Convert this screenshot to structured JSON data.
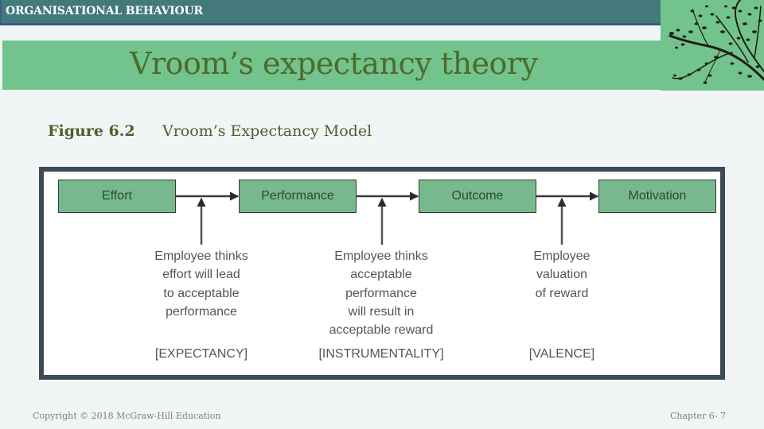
{
  "header": {
    "course_title": "ORGANISATIONAL BEHAVIOUR"
  },
  "slide": {
    "title": "Vroom’s expectancy theory"
  },
  "figure": {
    "label": "Figure 6.2",
    "caption": "Vroom’s Expectancy Model",
    "stages": [
      {
        "label": "Effort"
      },
      {
        "label": "Performance"
      },
      {
        "label": "Outcome"
      },
      {
        "label": "Motivation"
      }
    ],
    "links": [
      {
        "explanation": [
          "Employee thinks",
          "effort will lead",
          "to acceptable",
          "performance"
        ],
        "term": "[EXPECTANCY]"
      },
      {
        "explanation": [
          "Employee thinks",
          "acceptable",
          "performance",
          "will result in",
          "acceptable reward"
        ],
        "term": "[INSTRUMENTALITY]"
      },
      {
        "explanation": [
          "Employee",
          "valuation",
          "of reward"
        ],
        "term": "[VALENCE]"
      }
    ],
    "colors": {
      "stage_fill": "#77b98c",
      "frame": "#3c4a59",
      "arrow": "#2b2b2b"
    }
  },
  "decoration": {
    "image": "tree-branch-icon"
  },
  "footer": {
    "copyright": "Copyright © 2018 McGraw-Hill Education",
    "page": "Chapter 6- 7"
  }
}
